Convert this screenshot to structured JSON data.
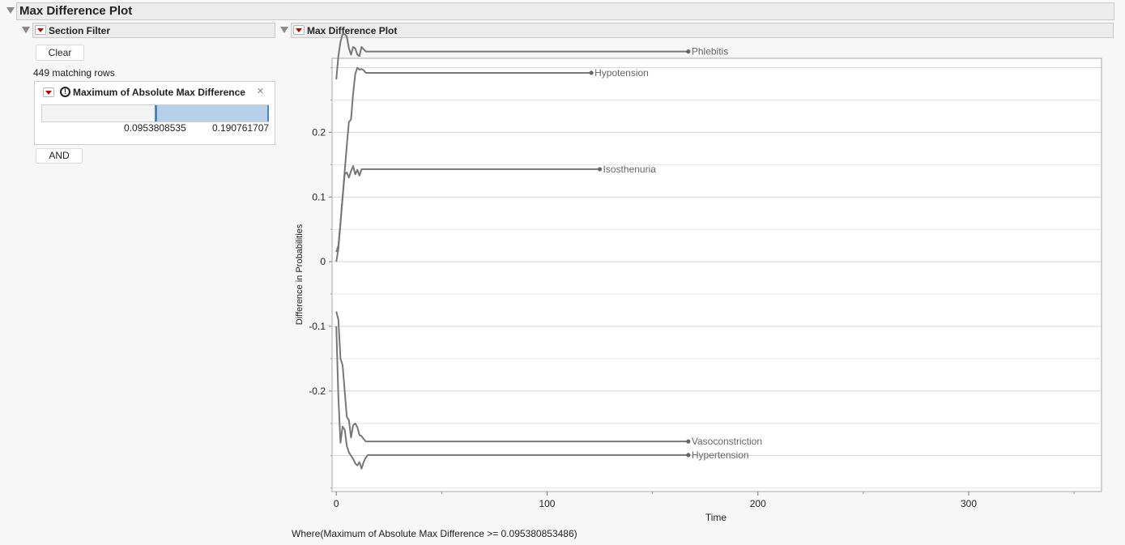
{
  "report": {
    "title": "Max Difference Plot"
  },
  "filter": {
    "title": "Section Filter",
    "clear_label": "Clear",
    "matching_rows": "449 matching rows",
    "condition": {
      "title": "Maximum of Absolute Max Difference",
      "low_value": "0.0953808535",
      "high_value": "0.190761707",
      "selected_fraction_start": 0.5
    },
    "and_label": "AND"
  },
  "plot": {
    "title": "Max Difference Plot",
    "where_clause": "Where(Maximum of Absolute Max Difference >= 0.095380853486)"
  },
  "chart_data": {
    "type": "line",
    "xlabel": "Time",
    "ylabel": "Difference in Probabilities",
    "xlim": [
      -2,
      363
    ],
    "ylim": [
      -0.3555,
      0.3145
    ],
    "x_ticks": [
      0,
      100,
      200,
      300
    ],
    "x_tick_labels": [
      "0",
      "100",
      "200",
      "300"
    ],
    "y_ticks": [
      -0.2,
      -0.1,
      0,
      0.1,
      0.2
    ],
    "y_tick_labels": [
      "-0.2",
      "-0.1",
      "0",
      "0.1",
      "0.2"
    ],
    "grid": true,
    "line_color": "#777777",
    "series": [
      {
        "name": "Phlebitis",
        "x": [
          0,
          1,
          2,
          3,
          4,
          5,
          6,
          7,
          8,
          9,
          10,
          11,
          12,
          14,
          167
        ],
        "y": [
          0.282,
          0.318,
          0.34,
          0.352,
          0.352,
          0.348,
          0.33,
          0.32,
          0.332,
          0.33,
          0.32,
          0.318,
          0.332,
          0.325,
          0.325
        ]
      },
      {
        "name": "Hypotension",
        "x": [
          0,
          1,
          2,
          3,
          4,
          5,
          6,
          7,
          8,
          9,
          10,
          11,
          12,
          13,
          14,
          16,
          121
        ],
        "y": [
          0.0,
          0.02,
          0.06,
          0.1,
          0.14,
          0.18,
          0.216,
          0.22,
          0.26,
          0.29,
          0.3,
          0.297,
          0.298,
          0.296,
          0.292,
          0.292,
          0.292
        ]
      },
      {
        "name": "Isosthenuria",
        "x": [
          0,
          1,
          2,
          3,
          4,
          5,
          6,
          7,
          8,
          9,
          10,
          11,
          12,
          13,
          125
        ],
        "y": [
          0.015,
          0.025,
          0.06,
          0.1,
          0.135,
          0.138,
          0.13,
          0.14,
          0.148,
          0.135,
          0.142,
          0.133,
          0.143,
          0.143,
          0.143
        ]
      },
      {
        "name": "Vasoconstriction",
        "x": [
          0,
          1,
          2,
          3,
          4,
          5,
          6,
          7,
          8,
          9,
          10,
          11,
          12,
          14,
          167
        ],
        "y": [
          -0.077,
          -0.09,
          -0.15,
          -0.16,
          -0.2,
          -0.24,
          -0.245,
          -0.272,
          -0.253,
          -0.25,
          -0.256,
          -0.268,
          -0.27,
          -0.278,
          -0.278
        ]
      },
      {
        "name": "Hypertension",
        "x": [
          0,
          1,
          2,
          3,
          4,
          5,
          6,
          7,
          8,
          9,
          10,
          11,
          12,
          13,
          14,
          15,
          167
        ],
        "y": [
          -0.1,
          -0.21,
          -0.28,
          -0.255,
          -0.26,
          -0.285,
          -0.295,
          -0.3,
          -0.305,
          -0.312,
          -0.315,
          -0.31,
          -0.32,
          -0.31,
          -0.303,
          -0.299,
          -0.299
        ]
      }
    ]
  }
}
